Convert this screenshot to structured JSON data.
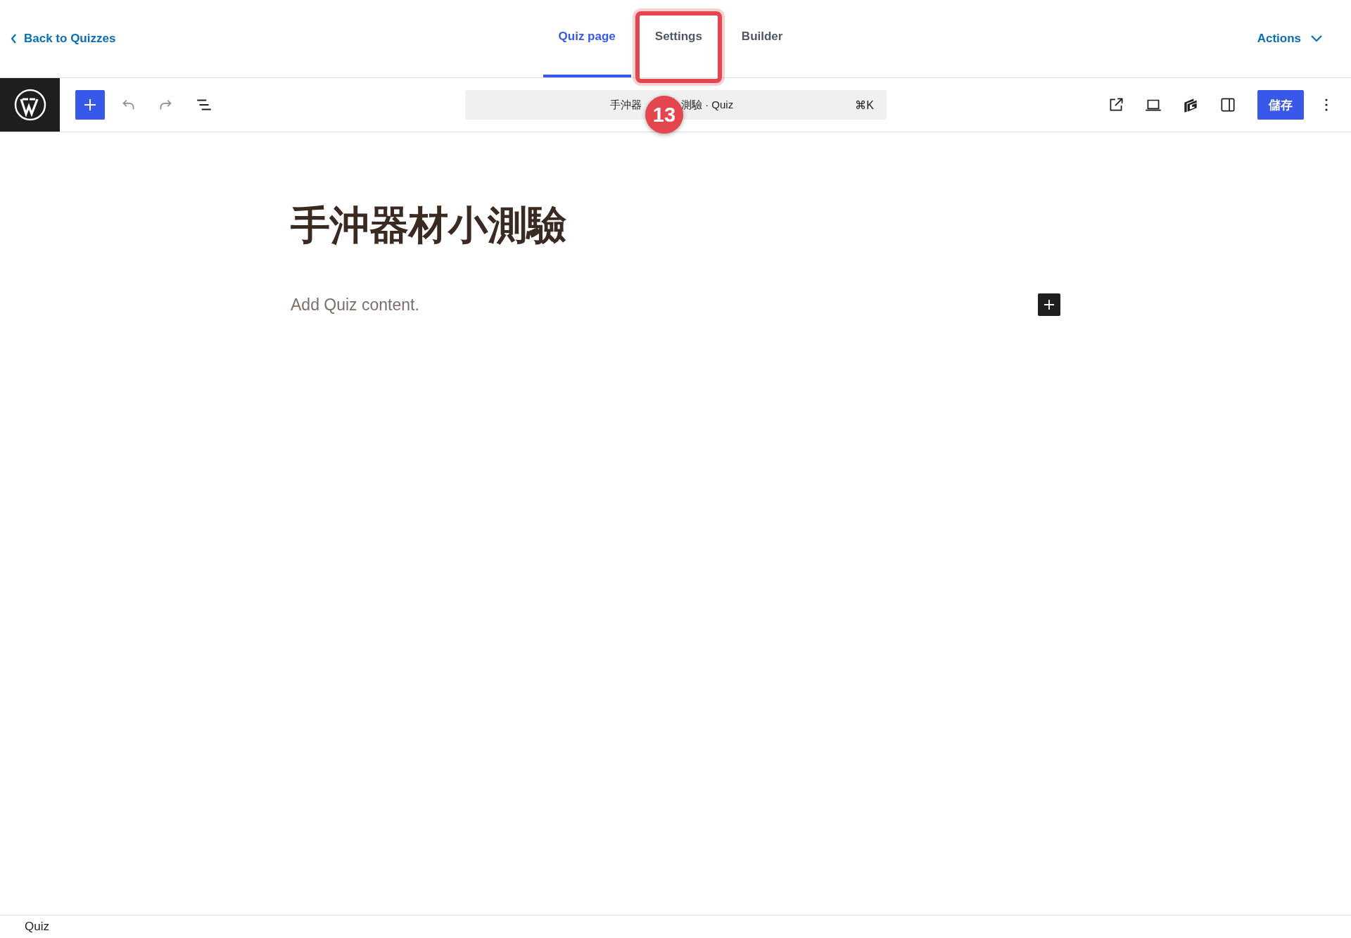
{
  "header": {
    "back_link": "Back to Quizzes",
    "tabs": [
      {
        "label": "Quiz page",
        "selected": true,
        "highlighted": false
      },
      {
        "label": "Settings",
        "selected": false,
        "highlighted": true
      },
      {
        "label": "Builder",
        "selected": false,
        "highlighted": false
      }
    ],
    "actions": "Actions"
  },
  "toolbar": {
    "command_bar": {
      "title_parts": [
        "手沖器",
        "測驗 · Quiz"
      ],
      "shortcut": "⌘K"
    },
    "save_button": "儲存"
  },
  "annotation": {
    "label": "13"
  },
  "editor": {
    "title": "手沖器材小測驗",
    "empty_hint": "Add Quiz content."
  },
  "status_bar": {
    "breadcrumb": "Quiz"
  }
}
